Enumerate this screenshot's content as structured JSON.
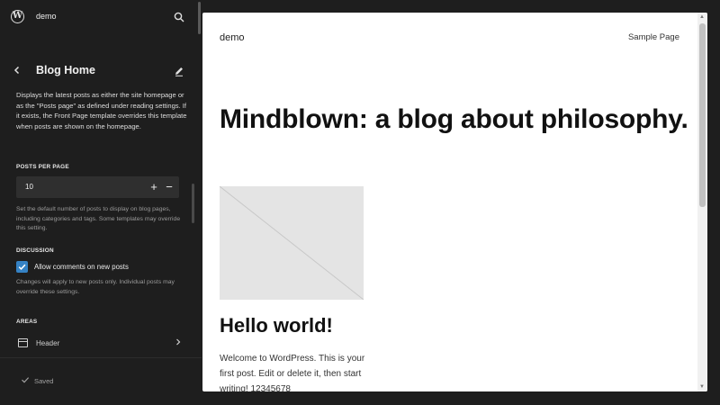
{
  "colors": {
    "background": "#1e1e1e",
    "accent": "#3582c4",
    "canvas": "#ffffff"
  },
  "topbar": {
    "logo_icon": "wordpress-logo",
    "site_name": "demo",
    "search_icon": "search-icon"
  },
  "template": {
    "back_icon": "chevron-left-icon",
    "title": "Blog Home",
    "edit_icon": "pencil-icon",
    "description": "Displays the latest posts as either the site homepage or as the \"Posts page\" as defined under reading settings. If it exists, the Front Page template overrides this template when posts are shown on the homepage."
  },
  "posts_per_page": {
    "label": "POSTS PER PAGE",
    "value": "10",
    "plus": "+",
    "minus": "−",
    "help": "Set the default number of posts to display on blog pages, including categories and tags. Some templates may override this setting."
  },
  "discussion": {
    "label": "DISCUSSION",
    "checkbox_label": "Allow comments on new posts",
    "checked": true,
    "help": "Changes will apply to new posts only. Individual posts may override these settings."
  },
  "areas": {
    "label": "AREAS",
    "items": [
      {
        "label": "Header",
        "icon": "layout-header-icon"
      }
    ]
  },
  "footer": {
    "status": "Saved",
    "status_icon": "check-icon"
  },
  "preview": {
    "site_title": "demo",
    "nav_link": "Sample Page",
    "headline": "Mindblown: a blog about philosophy.",
    "post_title": "Hello world!",
    "excerpt": "Welcome to WordPress. This is your first post. Edit or delete it, then start writing! 12345678"
  }
}
